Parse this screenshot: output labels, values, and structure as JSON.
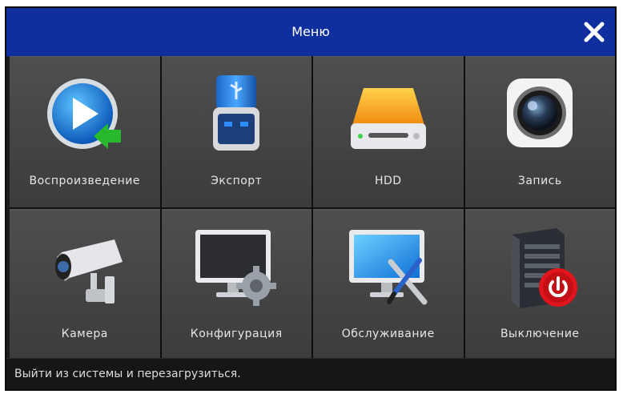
{
  "window": {
    "title": "Меню"
  },
  "tiles": [
    {
      "label": "Воспроизведение",
      "icon": "playback-icon"
    },
    {
      "label": "Экспорт",
      "icon": "usb-export-icon"
    },
    {
      "label": "HDD",
      "icon": "hdd-icon"
    },
    {
      "label": "Запись",
      "icon": "record-camera-lens-icon"
    },
    {
      "label": "Камера",
      "icon": "security-camera-icon"
    },
    {
      "label": "Конфигурация",
      "icon": "monitor-gear-icon"
    },
    {
      "label": "Обслуживание",
      "icon": "monitor-tools-icon"
    },
    {
      "label": "Выключение",
      "icon": "server-power-icon"
    }
  ],
  "status": {
    "text": "Выйти из системы и перезагрузиться."
  },
  "colors": {
    "titlebar": "#0f2f9e",
    "tile": "#484848",
    "background": "#1b1b1b",
    "text": "#e6e6e6"
  }
}
